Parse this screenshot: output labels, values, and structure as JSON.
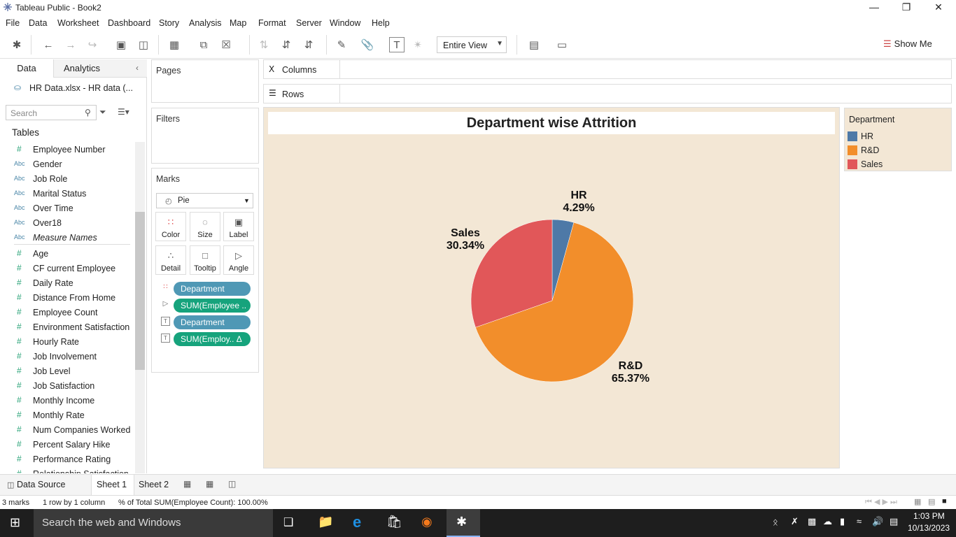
{
  "window": {
    "title": "Tableau Public - Book2"
  },
  "menu": [
    "File",
    "Data",
    "Worksheet",
    "Dashboard",
    "Story",
    "Analysis",
    "Map",
    "Format",
    "Server",
    "Window",
    "Help"
  ],
  "toolbar": {
    "view_mode": "Entire View",
    "show_me": "Show Me"
  },
  "left_pane": {
    "tabs": [
      "Data",
      "Analytics"
    ],
    "datasource": "HR Data.xlsx - HR data (...",
    "search_placeholder": "Search",
    "tables_label": "Tables",
    "fields": [
      {
        "type": "num",
        "name": "Employee Number"
      },
      {
        "type": "abc",
        "name": "Gender"
      },
      {
        "type": "abc",
        "name": "Job Role"
      },
      {
        "type": "abc",
        "name": "Marital Status"
      },
      {
        "type": "abc",
        "name": "Over Time"
      },
      {
        "type": "abc",
        "name": "Over18"
      },
      {
        "type": "abc",
        "name": "Measure Names"
      },
      {
        "type": "num",
        "name": "Age"
      },
      {
        "type": "num",
        "name": "CF current Employee"
      },
      {
        "type": "num",
        "name": "Daily Rate"
      },
      {
        "type": "num",
        "name": "Distance From Home"
      },
      {
        "type": "num",
        "name": "Employee Count"
      },
      {
        "type": "num",
        "name": "Environment Satisfaction"
      },
      {
        "type": "num",
        "name": "Hourly Rate"
      },
      {
        "type": "num",
        "name": "Job Involvement"
      },
      {
        "type": "num",
        "name": "Job Level"
      },
      {
        "type": "num",
        "name": "Job Satisfaction"
      },
      {
        "type": "num",
        "name": "Monthly Income"
      },
      {
        "type": "num",
        "name": "Monthly Rate"
      },
      {
        "type": "num",
        "name": "Num Companies Worked"
      },
      {
        "type": "num",
        "name": "Percent Salary Hike"
      },
      {
        "type": "num",
        "name": "Performance Rating"
      },
      {
        "type": "num",
        "name": "Relationship Satisfaction"
      }
    ]
  },
  "shelves": {
    "pages": "Pages",
    "filters": "Filters",
    "columns": "Columns",
    "rows": "Rows",
    "marks": "Marks",
    "mark_type": "Pie",
    "mark_buttons": [
      "Color",
      "Size",
      "Label",
      "Detail",
      "Tooltip",
      "Angle"
    ],
    "pills": [
      "Department",
      "SUM(Employee ..",
      "Department",
      "SUM(Employ.. Δ"
    ]
  },
  "legend": {
    "title": "Department",
    "items": [
      {
        "label": "HR",
        "color": "#4e79a7"
      },
      {
        "label": "R&D",
        "color": "#f28e2b"
      },
      {
        "label": "Sales",
        "color": "#e15759"
      }
    ]
  },
  "chart_data": {
    "type": "pie",
    "title": "Department wise Attrition",
    "categories": [
      "HR",
      "R&D",
      "Sales"
    ],
    "values": [
      4.29,
      65.37,
      30.34
    ],
    "labels": [
      "4.29%",
      "65.37%",
      "30.34%"
    ],
    "colors": [
      "#4e79a7",
      "#f28e2b",
      "#e15759"
    ]
  },
  "sheet_tabs": [
    "Data Source",
    "Sheet 1",
    "Sheet 2"
  ],
  "status": {
    "marks": "3 marks",
    "dims": "1 row by 1 column",
    "summary": "% of Total SUM(Employee Count): 100.00%"
  },
  "taskbar": {
    "search": "Search the web and Windows",
    "time": "1:03 PM",
    "date": "10/13/2023"
  }
}
